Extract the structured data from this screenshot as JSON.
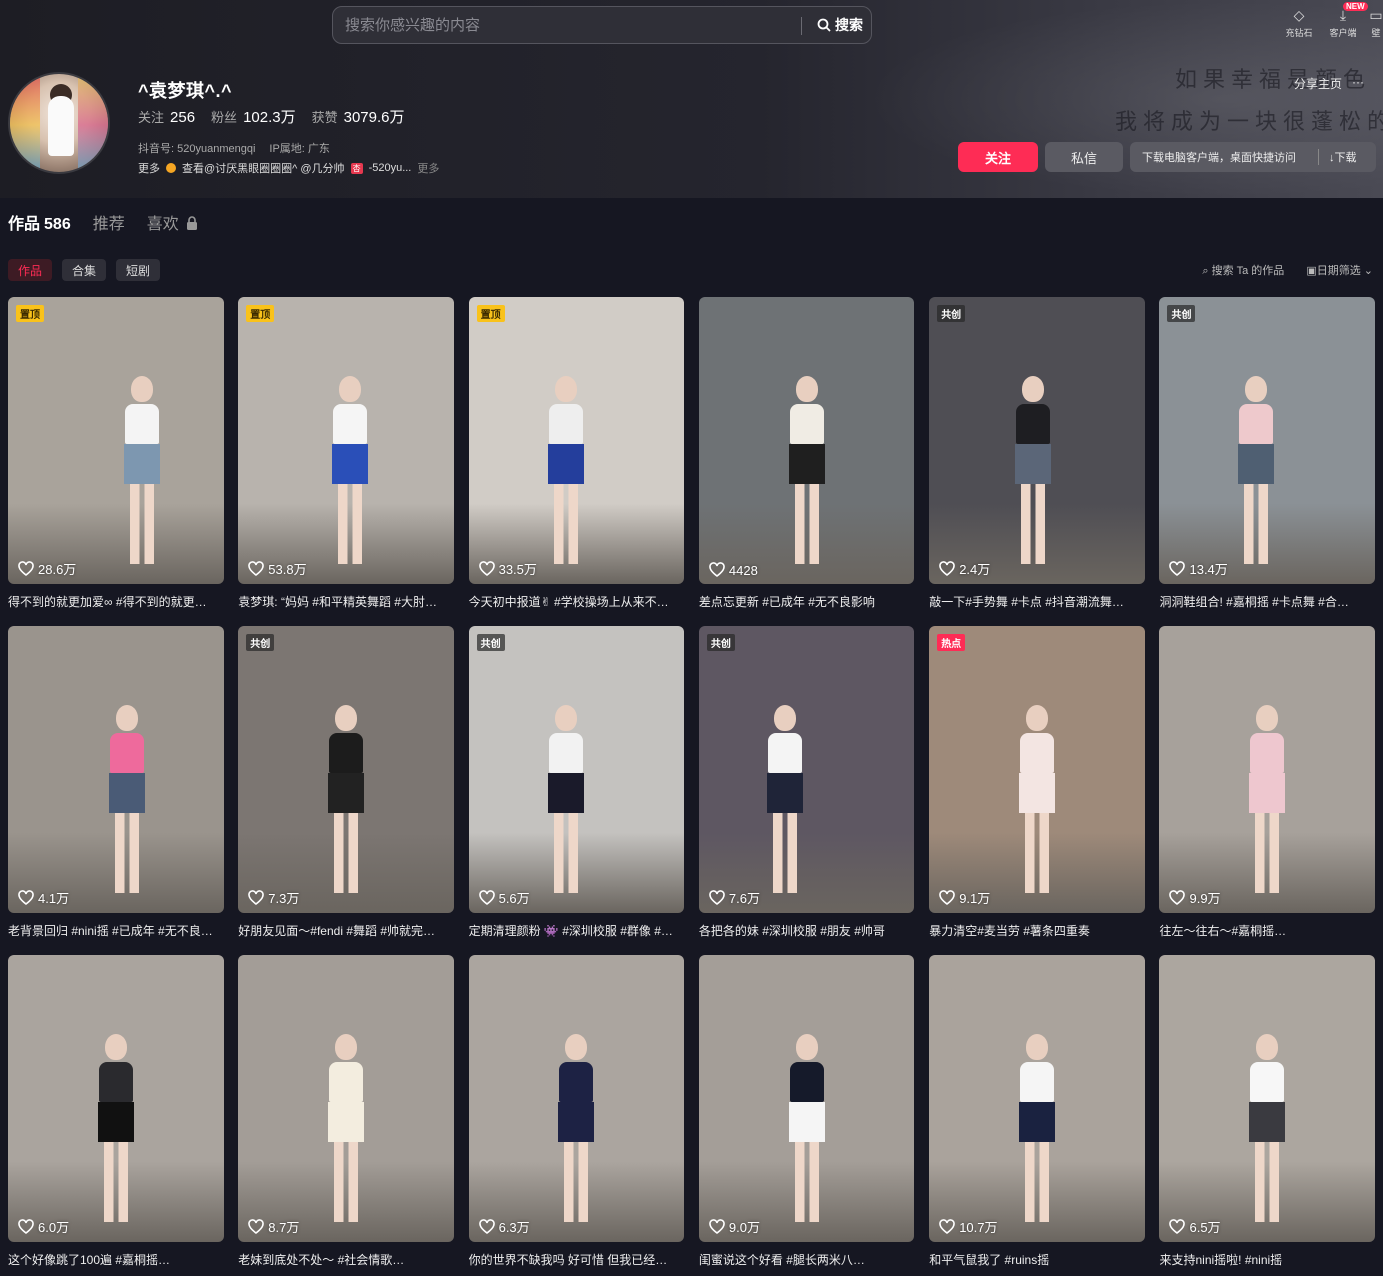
{
  "search": {
    "placeholder": "搜索你感兴趣的内容",
    "button": "搜索"
  },
  "topbar": {
    "items": [
      {
        "label": "充钻石",
        "icon": "diamond-icon"
      },
      {
        "label": "客户端",
        "icon": "download-icon",
        "badge": "NEW"
      },
      {
        "label": "壁",
        "icon": "wallpaper-icon"
      }
    ]
  },
  "profile": {
    "name": "^袁梦琪^.^",
    "follow_label": "关注",
    "follow_count": "256",
    "fans_label": "粉丝",
    "fans_count": "102.3万",
    "likes_label": "获赞",
    "likes_count": "3079.6万",
    "douyin_id": "抖音号: 520yuanmengqi",
    "ip": "IP属地: 广东",
    "more_prefix": "更多",
    "more_text": "查看@讨厌黑眼圈圈圈^ @几分帅",
    "more_tail": "-520yu...",
    "more_suffix": "更多",
    "school_badge": "杏",
    "handwriting_1": "如果幸福是颜色",
    "handwriting_2": "我将成为一块很蓬松的"
  },
  "actions": {
    "share": "分享主页",
    "more": "···",
    "follow": "关注",
    "message": "私信",
    "download_text": "下载电脑客户端，桌面快捷访问",
    "download": "↓下载"
  },
  "tabs": [
    {
      "label": "作品",
      "count": "586",
      "active": true
    },
    {
      "label": "推荐"
    },
    {
      "label": "喜欢"
    }
  ],
  "chips": [
    "作品",
    "合集",
    "短剧"
  ],
  "tools": {
    "search": "搜索 Ta 的作品",
    "date": "日期筛选"
  },
  "videos": [
    {
      "badge": "置顶",
      "badge_type": "pin",
      "likes": "28.6万",
      "title": "得不到的就更加爱∞ #得不到的就更…",
      "bg": "#a9a39b",
      "top": "#f4f4f4",
      "bottom": "#7d97b0",
      "x": 62
    },
    {
      "badge": "置顶",
      "badge_type": "pin",
      "likes": "53.8万",
      "title": "袁梦琪: “妈妈 #和平精英舞蹈 #大肘…",
      "bg": "#b8b3ad",
      "top": "#f5f5f5",
      "bottom": "#2a4fb8",
      "x": 52
    },
    {
      "badge": "置顶",
      "badge_type": "pin",
      "likes": "33.5万",
      "title": "今天初中报道✌ #学校操场上从来不…",
      "bg": "#d1ccc6",
      "top": "#eeeeee",
      "bottom": "#243e9c",
      "x": 45
    },
    {
      "badge": "",
      "badge_type": "",
      "likes": "4428",
      "title": "差点忘更新 #已成年 #无不良影响",
      "bg": "#6e7275",
      "top": "#f0ece4",
      "bottom": "#1f1f1f",
      "x": 50
    },
    {
      "badge": "共创",
      "badge_type": "co",
      "likes": "2.4万",
      "title": "敲一下#手势舞 #卡点 #抖音潮流舞…",
      "bg": "#4f4e54",
      "top": "#1e1e22",
      "bottom": "#5b6678",
      "x": 48
    },
    {
      "badge": "共创",
      "badge_type": "co",
      "likes": "13.4万",
      "title": "洞洞鞋组合! #嘉桐摇 #卡点舞 #合…",
      "bg": "#8b9196",
      "top": "#eec9cc",
      "bottom": "#4f5f72",
      "x": 45
    },
    {
      "badge": "",
      "badge_type": "",
      "likes": "4.1万",
      "title": "老背景回归 #nini摇 #已成年 #无不良…",
      "bg": "#9a948d",
      "top": "#ee6a9c",
      "bottom": "#4a5b76",
      "x": 55
    },
    {
      "badge": "共创",
      "badge_type": "co",
      "likes": "7.3万",
      "title": "好朋友见面～#fendi #舞蹈 #帅就完…",
      "bg": "#7c7672",
      "top": "#1c1c1c",
      "bottom": "#222222",
      "x": 50
    },
    {
      "badge": "共创",
      "badge_type": "co",
      "likes": "5.6万",
      "title": "定期清理颜粉 👾 #深圳校服 #群像 #…",
      "bg": "#c4c2bf",
      "top": "#f2f2f2",
      "bottom": "#1a1a2a",
      "x": 45
    },
    {
      "badge": "共创",
      "badge_type": "co",
      "likes": "7.6万",
      "title": "各把各的妹 #深圳校服 #朋友 #帅哥",
      "bg": "#5e5762",
      "top": "#f4f4f4",
      "bottom": "#1f2438",
      "x": 40
    },
    {
      "badge": "热点",
      "badge_type": "hot",
      "likes": "9.1万",
      "title": "暴力清空#麦当劳 #薯条四重奏",
      "bg": "#9e8a7a",
      "top": "#f3e5e2",
      "bottom": "#f3e5e2",
      "x": 50
    },
    {
      "badge": "",
      "badge_type": "",
      "likes": "9.9万",
      "title": "往左～往右～#嘉桐摇…",
      "bg": "#a7a19b",
      "top": "#eec7cf",
      "bottom": "#eec7cf",
      "x": 50
    },
    {
      "badge": "",
      "badge_type": "",
      "likes": "6.0万",
      "title": "这个好像跳了100遍 #嘉桐摇…",
      "bg": "#aaa49e",
      "top": "#2a2a2e",
      "bottom": "#111111",
      "x": 50
    },
    {
      "badge": "",
      "badge_type": "",
      "likes": "8.7万",
      "title": "老妹到底处不处～ #社会情歌…",
      "bg": "#a39d97",
      "top": "#f3eddf",
      "bottom": "#f3eddf",
      "x": 50
    },
    {
      "badge": "",
      "badge_type": "",
      "likes": "6.3万",
      "title": "你的世界不缺我吗 好可惜 但我已经…",
      "bg": "#aba59f",
      "top": "#1d2244",
      "bottom": "#1d2244",
      "x": 50
    },
    {
      "badge": "",
      "badge_type": "",
      "likes": "9.0万",
      "title": "闺蜜说这个好看 #腿长两米八…",
      "bg": "#a49e98",
      "top": "#151a2a",
      "bottom": "#f5f5f5",
      "x": 50
    },
    {
      "badge": "",
      "badge_type": "",
      "likes": "10.7万",
      "title": "和平气鼠我了 #ruins摇",
      "bg": "#aaa39c",
      "top": "#f5f5f5",
      "bottom": "#1a2240",
      "x": 50
    },
    {
      "badge": "",
      "badge_type": "",
      "likes": "6.5万",
      "title": "来支持nini摇啦! #nini摇",
      "bg": "#aca69f",
      "top": "#f7f7f7",
      "bottom": "#3a3a40",
      "x": 50
    }
  ],
  "colors": {
    "accent": "#fe2c55",
    "background": "#161722",
    "pin_badge": "#f9c21b"
  }
}
